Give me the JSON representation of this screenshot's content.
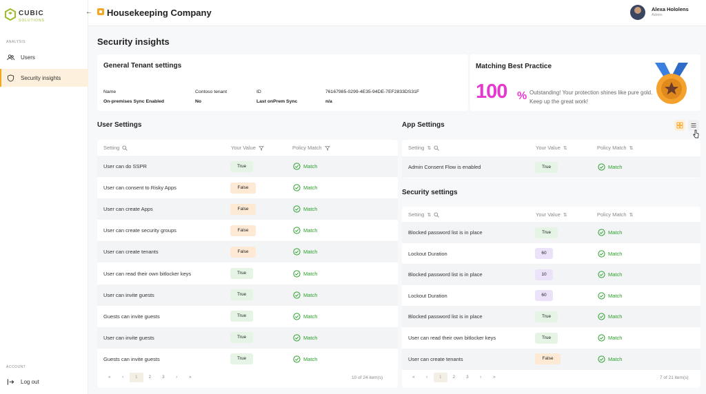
{
  "brand": {
    "name": "CUBIC",
    "sub": "SOLUTIONS"
  },
  "sidebar": {
    "analysis_label": "ANALYSIS",
    "items": [
      {
        "label": "Users",
        "icon": "users-icon"
      },
      {
        "label": "Security insights",
        "icon": "shield-icon",
        "active": true
      }
    ],
    "account_label": "ACCOUNT",
    "logout": "Log out"
  },
  "header": {
    "back": "←",
    "company": "Housekeeping Company",
    "user": {
      "name": "Alexa Hololens",
      "role": "Admin"
    }
  },
  "page_title": "Security insights",
  "general": {
    "title": "General Tenant settings",
    "name_label": "Name",
    "name_value": "Contoso tenant",
    "id_label": "ID",
    "id_value": "76167985-0299-4E35-94DE-7EF2833DS31F",
    "sync_label": "On-premises Sync Enabled",
    "sync_value": "No",
    "last_sync_label": "Last onPrem Sync",
    "last_sync_value": "n/a"
  },
  "best_practice": {
    "title": "Matching Best Practice",
    "value": "100",
    "unit": "%",
    "text": "Outstanding! Your protection shines like pure gold. Keep up the great work!"
  },
  "user_settings": {
    "title": "User Settings",
    "headers": {
      "setting": "Setting",
      "value": "Your Value",
      "match": "Policy Match"
    },
    "rows": [
      {
        "setting": "User can do SSPR",
        "value": "True",
        "match": "Match"
      },
      {
        "setting": "User can consent to Risky Apps",
        "value": "False",
        "match": "Match"
      },
      {
        "setting": "User can create Apps",
        "value": "False",
        "match": "Match"
      },
      {
        "setting": "User can create security groups",
        "value": "False",
        "match": "Match"
      },
      {
        "setting": "User can create tenants",
        "value": "False",
        "match": "Match"
      },
      {
        "setting": "User can read their own bitlocker keys",
        "value": "True",
        "match": "Match"
      },
      {
        "setting": "User can invite guests",
        "value": "True",
        "match": "Match"
      },
      {
        "setting": "Guests can invite guests",
        "value": "True",
        "match": "Match"
      },
      {
        "setting": "User can invite guests",
        "value": "True",
        "match": "Match"
      },
      {
        "setting": "Guests can invite guests",
        "value": "True",
        "match": "Match"
      }
    ],
    "pager": {
      "pages": [
        "«",
        "‹",
        "1",
        "2",
        "3",
        "›",
        "»"
      ],
      "count": "10 of 24 item(s)"
    }
  },
  "app_settings": {
    "title": "App Settings",
    "headers": {
      "setting": "Setting",
      "value": "Your Value",
      "match": "Policy Match"
    },
    "rows": [
      {
        "setting": "Admin Consent Flow is enabled",
        "value": "True",
        "match": "Match"
      }
    ]
  },
  "security_settings": {
    "title": "Security settings",
    "headers": {
      "setting": "Setting",
      "value": "Your Value",
      "match": "Policy Match"
    },
    "rows": [
      {
        "setting": "Blocked password list is in place",
        "value": "True",
        "match": "Match"
      },
      {
        "setting": "Lockout Duration",
        "value": "60",
        "match": "Match"
      },
      {
        "setting": "Blocked password list is in place",
        "value": "10",
        "match": "Match"
      },
      {
        "setting": "Lockout Duration",
        "value": "60",
        "match": "Match"
      },
      {
        "setting": "Blocked password list is in place",
        "value": "True",
        "match": "Match"
      },
      {
        "setting": "User can read their own bitlocker keys",
        "value": "True",
        "match": "Match"
      },
      {
        "setting": "User can create tenants",
        "value": "False",
        "match": "Match"
      }
    ],
    "pager": {
      "pages": [
        "«",
        "‹",
        "1",
        "2",
        "3",
        "›",
        "»"
      ],
      "count": "7 of 21 item(s)"
    }
  },
  "colors": {
    "accent": "#f5a623",
    "magenta": "#e637d0",
    "green": "#2aa02a"
  }
}
